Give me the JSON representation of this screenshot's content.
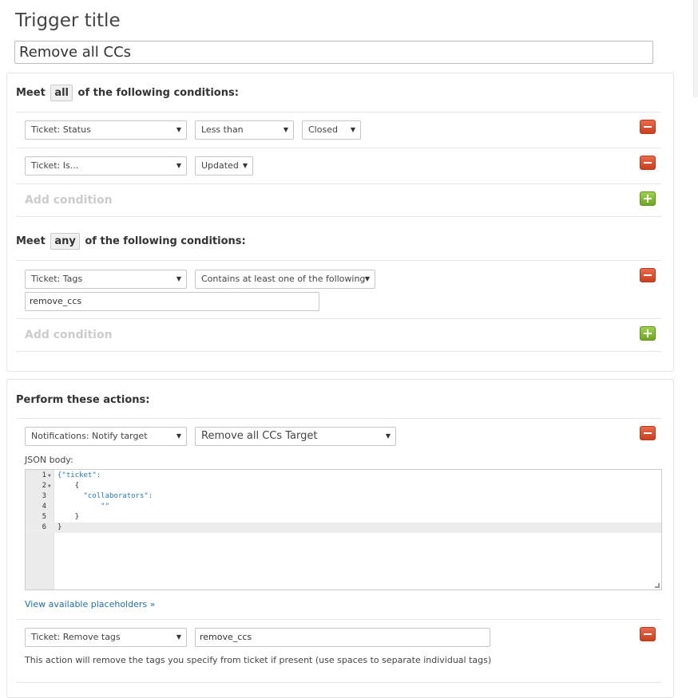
{
  "title_heading": "Trigger title",
  "title_value": "Remove all CCs",
  "all_section": {
    "prefix": "Meet",
    "pill": "all",
    "suffix": "of the following conditions:",
    "rows": [
      {
        "field": "Ticket: Status",
        "operator": "Less than",
        "value": "Closed"
      },
      {
        "field": "Ticket: Is...",
        "operator": "Updated"
      }
    ],
    "add_label": "Add condition"
  },
  "any_section": {
    "prefix": "Meet",
    "pill": "any",
    "suffix": "of the following conditions:",
    "rows": [
      {
        "field": "Ticket: Tags",
        "operator": "Contains at least one of the following",
        "input": "remove_ccs"
      }
    ],
    "add_label": "Add condition"
  },
  "actions": {
    "heading": "Perform these actions:",
    "notify": {
      "field": "Notifications: Notify target",
      "target": "Remove all CCs Target",
      "json_label": "JSON body:",
      "code_lines": [
        {
          "num": "1",
          "fold": true,
          "text": "{\"ticket\":"
        },
        {
          "num": "2",
          "fold": true,
          "text": "    {"
        },
        {
          "num": "3",
          "fold": false,
          "text": "      \"collaborators\":"
        },
        {
          "num": "4",
          "fold": false,
          "text": "          \"\""
        },
        {
          "num": "5",
          "fold": false,
          "text": "    }"
        },
        {
          "num": "6",
          "fold": false,
          "text": "}"
        }
      ],
      "placeholders_link": "View available placeholders »"
    },
    "remove_tags": {
      "field": "Ticket: Remove tags",
      "input": "remove_ccs",
      "help": "This action will remove the tags you specify from ticket if present (use spaces to separate individual tags)"
    }
  }
}
